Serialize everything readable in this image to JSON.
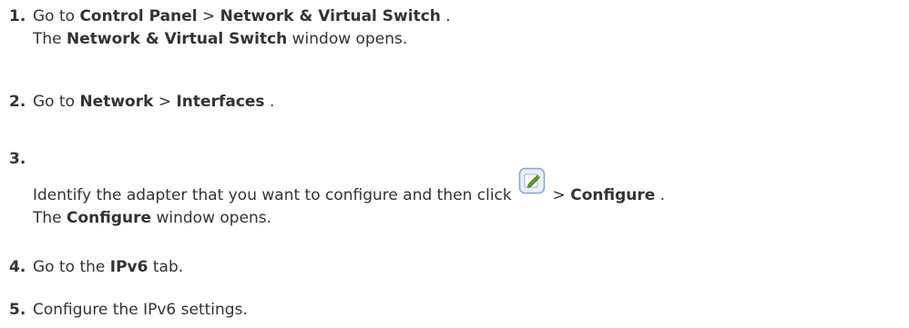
{
  "steps": [
    {
      "number": "1.",
      "line1": {
        "prefix": "Go to ",
        "b1": "Control Panel",
        "sep": " > ",
        "b2": "Network & Virtual Switch",
        "suffix": " ."
      },
      "line2": {
        "prefix": "The ",
        "b1": "Network & Virtual Switch",
        "suffix": " window opens."
      }
    },
    {
      "number": "2.",
      "line1": {
        "prefix": "Go to ",
        "b1": "Network",
        "sep": " > ",
        "b2": "Interfaces",
        "suffix": " ."
      }
    },
    {
      "number": "3.",
      "line1": {
        "prefix": "Identify the adapter that you want to configure and then click ",
        "icon": "edit-icon",
        "sep": " > ",
        "b1": "Configure",
        "suffix": " ."
      },
      "line2": {
        "prefix": "The ",
        "b1": "Configure",
        "suffix": " window opens."
      }
    },
    {
      "number": "4.",
      "line1": {
        "prefix": "Go to the ",
        "b1": "IPv6",
        "suffix": " tab."
      }
    },
    {
      "number": "5.",
      "line1": {
        "text": "Configure the IPv6 settings."
      }
    }
  ],
  "colors": {
    "text": "#333333",
    "icon_border": "#7aa8d8",
    "icon_fill": "#e8f0fa",
    "pencil": "#5b9a2f"
  }
}
